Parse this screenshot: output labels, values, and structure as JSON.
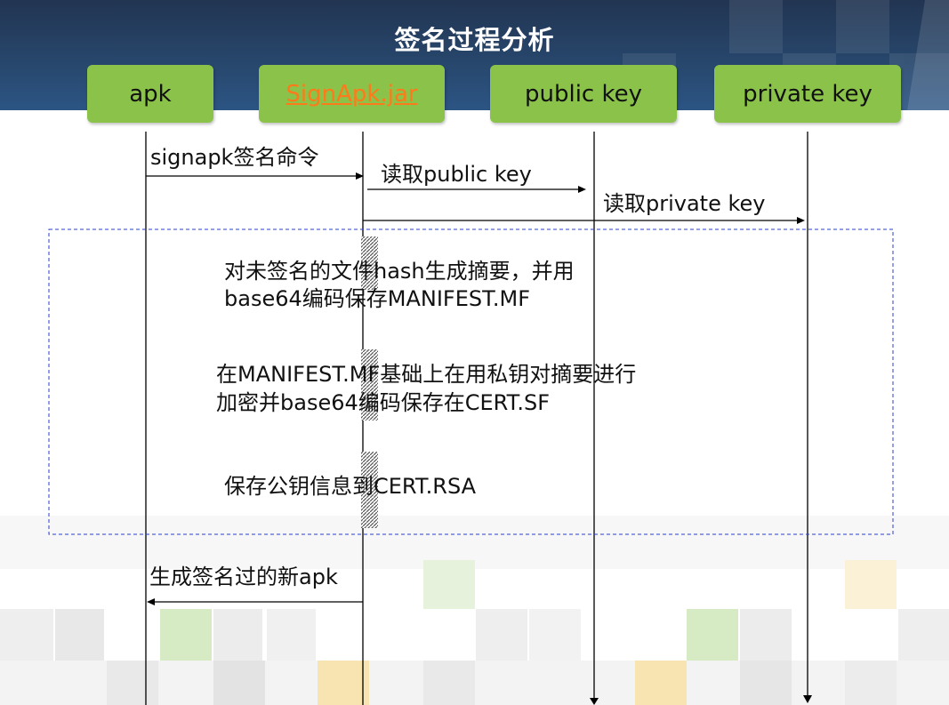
{
  "title": "签名过程分析",
  "lifelines": [
    {
      "id": "apk",
      "label": "apk"
    },
    {
      "id": "signapk",
      "label": "SignApk.jar"
    },
    {
      "id": "public_key",
      "label": "public key"
    },
    {
      "id": "private_key",
      "label": "private key"
    }
  ],
  "messages": {
    "m1": "signapk签名命令",
    "m2": "读取public key",
    "m3": "读取private key",
    "step1_line1": "对未签名的文件hash生成摘要，并用",
    "step1_line2": "base64编码保存MANIFEST.MF",
    "step2_line1": "在MANIFEST.MF基础上在用私钥对摘要进行",
    "step2_line2": "加密并base64编码保存在CERT.SF",
    "step3": "保存公钥信息到CERT.RSA",
    "m4": "生成签名过的新apk"
  },
  "colors": {
    "header": "#27466b",
    "lifeline_box": "#8bc34a",
    "link_text": "#ff7a1a",
    "dashed_frame": "#2b3fd1"
  }
}
